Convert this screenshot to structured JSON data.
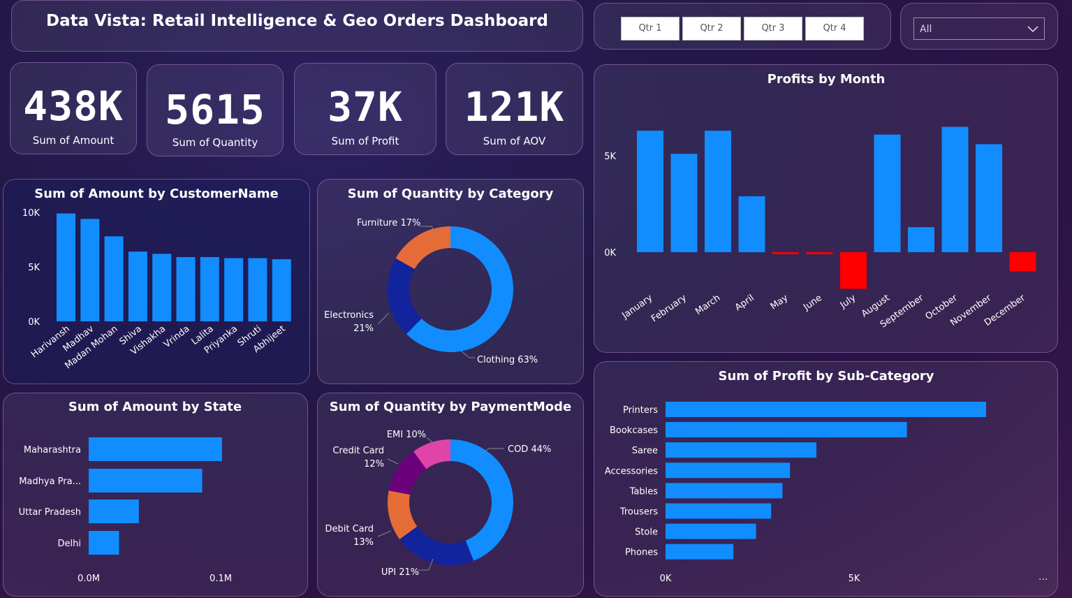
{
  "title": "Data Vista: Retail Intelligence & Geo Orders Dashboard",
  "quarters": [
    "Qtr 1",
    "Qtr 2",
    "Qtr 3",
    "Qtr 4"
  ],
  "dropdown": {
    "selected": "All"
  },
  "colors": {
    "bar": "#118dff",
    "negative": "#ff0000",
    "orange": "#e66c37",
    "navy": "#12239e",
    "purple": "#6b007b",
    "pink": "#e044a7"
  },
  "kpis": [
    {
      "value": "438K",
      "label": "Sum of Amount"
    },
    {
      "value": "5615",
      "label": "Sum of Quantity"
    },
    {
      "value": "37K",
      "label": "Sum of Profit"
    },
    {
      "value": "121K",
      "label": "Sum of AOV"
    }
  ],
  "chart_data": [
    {
      "type": "bar",
      "title": "Sum of Amount by CustomerName",
      "categories": [
        "Harivansh",
        "Madhav",
        "Madan Mohan",
        "Shiva",
        "Vishakha",
        "Vrinda",
        "Lalita",
        "Priyanka",
        "Shruti",
        "Abhijeet"
      ],
      "values": [
        9900,
        9400,
        7800,
        6400,
        6200,
        5900,
        5900,
        5800,
        5800,
        5700
      ],
      "ylim": [
        0,
        10000
      ],
      "yticks": [
        "0K",
        "5K",
        "10K"
      ],
      "grid": false
    },
    {
      "type": "pie",
      "title": "Sum of Quantity by Category",
      "labels": [
        "Clothing",
        "Electronics",
        "Furniture"
      ],
      "values": [
        63,
        21,
        17
      ],
      "display_labels": [
        "Clothing 63%",
        "Electronics",
        "21%",
        "Furniture 17%"
      ],
      "colors": [
        "#118dff",
        "#12239e",
        "#e66c37"
      ]
    },
    {
      "type": "bar",
      "title": "Profits by Month",
      "categories": [
        "January",
        "February",
        "March",
        "April",
        "May",
        "June",
        "July",
        "August",
        "September",
        "October",
        "November",
        "December"
      ],
      "values": [
        6300,
        5100,
        6300,
        2900,
        -100,
        -100,
        -1900,
        6100,
        1300,
        6500,
        5600,
        -1000
      ],
      "ylim": [
        -2000,
        7000
      ],
      "yticks": [
        "0K",
        "5K"
      ],
      "grid": false
    },
    {
      "type": "bar",
      "orientation": "horizontal",
      "title": "Sum of Amount by State",
      "categories": [
        "Maharashtra",
        "Madhya Pra...",
        "Uttar Pradesh",
        "Delhi"
      ],
      "values": [
        101000,
        86000,
        38000,
        23000
      ],
      "xlim": [
        0,
        100000
      ],
      "xticks": [
        "0.0M",
        "0.1M"
      ],
      "grid": false
    },
    {
      "type": "pie",
      "title": "Sum of Quantity by PaymentMode",
      "labels": [
        "COD",
        "UPI",
        "Debit Card",
        "Credit Card",
        "EMI"
      ],
      "values": [
        44,
        21,
        13,
        12,
        10
      ],
      "display_labels": [
        "COD 44%",
        "UPI 21%",
        "Debit Card",
        "13%",
        "Credit Card",
        "12%",
        "EMI 10%"
      ],
      "colors": [
        "#118dff",
        "#12239e",
        "#e66c37",
        "#6b007b",
        "#e044a7"
      ]
    },
    {
      "type": "bar",
      "orientation": "horizontal",
      "title": "Sum of Profit by Sub-Category",
      "categories": [
        "Printers",
        "Bookcases",
        "Saree",
        "Accessories",
        "Tables",
        "Trousers",
        "Stole",
        "Phones"
      ],
      "values": [
        8500,
        6400,
        4000,
        3300,
        3100,
        2800,
        2400,
        1800
      ],
      "xlim": [
        0,
        5000
      ],
      "xticks": [
        "0K",
        "5K"
      ],
      "grid": false
    }
  ],
  "more_icon": "..."
}
